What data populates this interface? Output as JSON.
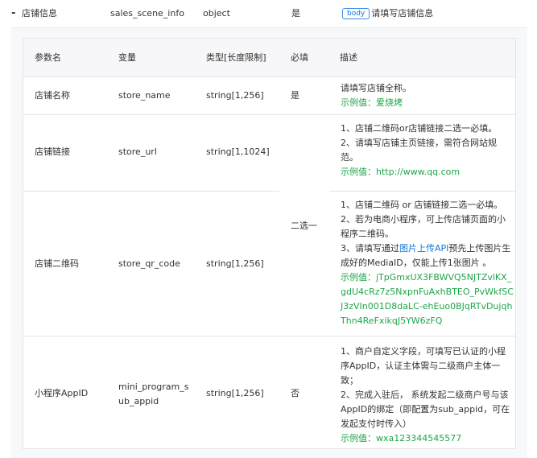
{
  "parent": {
    "collapse_glyph": "-",
    "name": "店铺信息",
    "variable": "sales_scene_info",
    "type": "object",
    "required": "是",
    "badge": "body",
    "description": "请填写店铺信息"
  },
  "table": {
    "headers": {
      "name": "参数名",
      "variable": "变量",
      "type": "类型[长度限制]",
      "required": "必填",
      "description": "描述"
    },
    "rows": [
      {
        "name": "店铺名称",
        "variable": "store_name",
        "type": "string[1,256]",
        "required": "是",
        "desc": [
          "请填写店铺全称。"
        ],
        "example": "示例值：爱烧烤"
      },
      {
        "name": "店铺链接",
        "variable": "store_url",
        "type": "string[1,1024]",
        "desc": [
          "1、店铺二维码or店铺链接二选一必填。",
          "2、请填写店铺主页链接，需符合网站规范。"
        ],
        "example": "示例值：http://www.qq.com"
      },
      {
        "name": "店铺二维码",
        "variable": "store_qr_code",
        "type": "string[1,256]",
        "desc": [
          "1、店铺二维码 or 店铺链接二选一必填。",
          "2、若为电商小程序，可上传店铺页面的小程序二维码。"
        ],
        "desc3_prefix": "3、请填写通过",
        "desc3_link": "图片上传API",
        "desc3_suffix": "预先上传图片生成好的MediaID，仅能上传1张图片 。",
        "example": "示例值：jTpGmxUX3FBWVQ5NJTZvlKX_gdU4cRz7z5NxpnFuAxhBTEO_PvWkfSCJ3zVIn001D8daLC-ehEuo0BJqRTvDujqhThn4ReFxikqJ5YW6zFQ"
      },
      {
        "name": "小程序AppID",
        "variable": "mini_program_sub_appid",
        "variable_line1": "mini_program_s",
        "variable_line2": "ub_appid",
        "type": "string[1,256]",
        "required": "否",
        "desc": [
          "1、商户自定义字段，可填写已认证的小程序AppID，认证主体需与二级商户主体一致；",
          "2、完成入驻后， 系统发起二级商户号与该AppID的绑定（即配置为sub_appid，可在发起支付时传入）"
        ],
        "example": "示例值：wxa123344545577"
      }
    ],
    "merged_required": "二选一"
  }
}
